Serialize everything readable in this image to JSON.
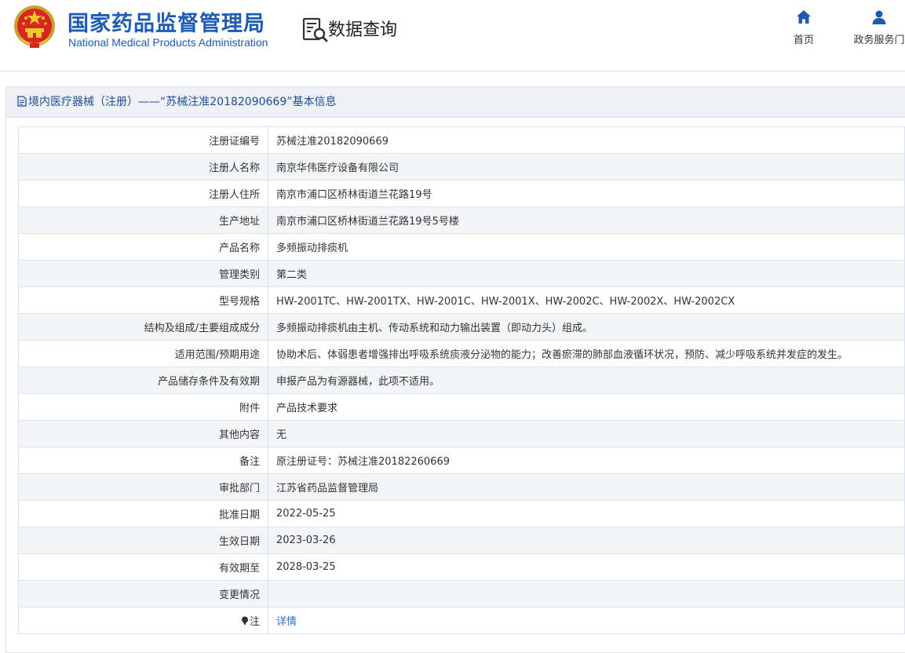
{
  "header": {
    "agency_cn": "国家药品监督管理局",
    "agency_en": "National Medical Products Administration",
    "page_title": "数据查询",
    "nav": {
      "home_label": "首页",
      "portal_label": "政务服务门"
    }
  },
  "panel": {
    "title": "境内医疗器械（注册）——“苏械注准20182090669”基本信息"
  },
  "details": [
    {
      "label": "注册证编号",
      "value": "苏械注准20182090669"
    },
    {
      "label": "注册人名称",
      "value": "南京华伟医疗设备有限公司"
    },
    {
      "label": "注册人住所",
      "value": "南京市浦口区桥林街道兰花路19号"
    },
    {
      "label": "生产地址",
      "value": "南京市浦口区桥林街道兰花路19号5号楼"
    },
    {
      "label": "产品名称",
      "value": "多频振动排痰机"
    },
    {
      "label": "管理类别",
      "value": "第二类"
    },
    {
      "label": "型号规格",
      "value": "HW-2001TC、HW-2001TX、HW-2001C、HW-2001X、HW-2002C、HW-2002X、HW-2002CX"
    },
    {
      "label": "结构及组成/主要组成成分",
      "value": "多频振动排痰机由主机、传动系统和动力输出装置（即动力头）组成。"
    },
    {
      "label": "适用范围/预期用途",
      "value": "协助术后、体弱患者增强排出呼吸系统痰液分泌物的能力；改善瘀滞的肺部血液循环状况，预防、减少呼吸系统并发症的发生。"
    },
    {
      "label": "产品储存条件及有效期",
      "value": "申报产品为有源器械，此项不适用。"
    },
    {
      "label": "附件",
      "value": "产品技术要求"
    },
    {
      "label": "其他内容",
      "value": "无"
    },
    {
      "label": "备注",
      "value": "原注册证号：苏械注准20182260669"
    },
    {
      "label": "审批部门",
      "value": "江苏省药品监督管理局"
    },
    {
      "label": "批准日期",
      "value": "2022-05-25"
    },
    {
      "label": "生效日期",
      "value": "2023-03-26"
    },
    {
      "label": "有效期至",
      "value": "2028-03-25"
    },
    {
      "label": "变更情况",
      "value": ""
    }
  ],
  "note_row": {
    "label": "注",
    "link_text": "详情",
    "icon": "pin-icon"
  },
  "colors": {
    "brand_blue": "#1e5bb4",
    "link_blue": "#2e6fc4",
    "title_blue": "#1e4f96",
    "row_alt": "#f4f5f7",
    "border": "#dde3ea"
  }
}
